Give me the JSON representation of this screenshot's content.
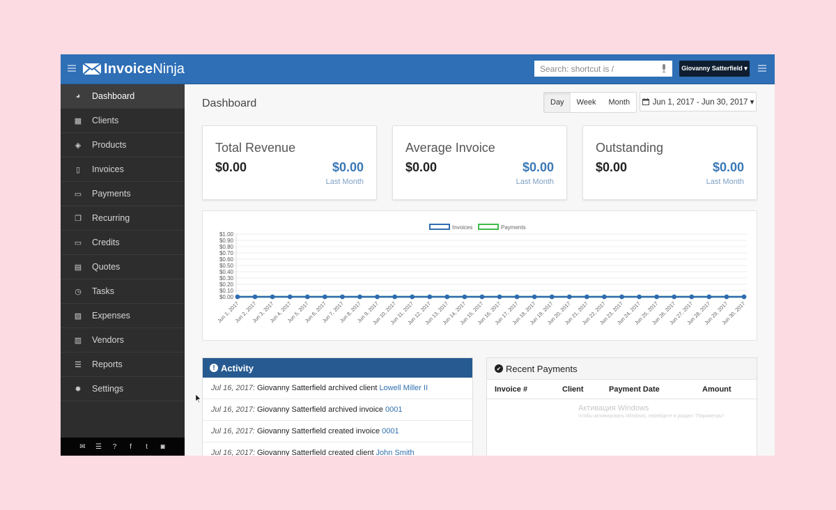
{
  "app": {
    "logo_bold": "Invoice",
    "logo_light": "Ninja"
  },
  "topbar": {
    "search_placeholder": "Search: shortcut is /",
    "user_name": "Giovanny Satterfield ▾"
  },
  "sidebar": {
    "items": [
      {
        "label": "Dashboard",
        "icon": "dashboard-icon",
        "active": true
      },
      {
        "label": "Clients",
        "icon": "users-icon"
      },
      {
        "label": "Products",
        "icon": "cube-icon"
      },
      {
        "label": "Invoices",
        "icon": "file-pdf-icon"
      },
      {
        "label": "Payments",
        "icon": "credit-card-icon"
      },
      {
        "label": "Recurring",
        "icon": "files-icon"
      },
      {
        "label": "Credits",
        "icon": "credit-card-icon"
      },
      {
        "label": "Quotes",
        "icon": "file-text-icon"
      },
      {
        "label": "Tasks",
        "icon": "clock-icon"
      },
      {
        "label": "Expenses",
        "icon": "file-image-icon"
      },
      {
        "label": "Vendors",
        "icon": "building-icon"
      },
      {
        "label": "Reports",
        "icon": "list-icon"
      },
      {
        "label": "Settings",
        "icon": "gear-icon"
      }
    ],
    "footer_icons": [
      "envelope-icon",
      "list-icon",
      "question-icon",
      "facebook-icon",
      "twitter-icon",
      "github-icon"
    ]
  },
  "main": {
    "title": "Dashboard",
    "range_buttons": [
      {
        "label": "Day",
        "active": true
      },
      {
        "label": "Week"
      },
      {
        "label": "Month"
      }
    ],
    "date_range": "Jun 1, 2017 - Jun 30, 2017 ▾",
    "cards": [
      {
        "label": "Total Revenue",
        "value": "$0.00",
        "compare_value": "$0.00",
        "compare_label": "Last Month"
      },
      {
        "label": "Average Invoice",
        "value": "$0.00",
        "compare_value": "$0.00",
        "compare_label": "Last Month"
      },
      {
        "label": "Outstanding",
        "value": "$0.00",
        "compare_value": "$0.00",
        "compare_label": "Last Month"
      }
    ]
  },
  "chart_data": {
    "type": "line",
    "title": "",
    "xlabel": "",
    "ylabel": "",
    "legend_position": "top-center",
    "grid": true,
    "ylim": [
      0,
      1
    ],
    "yticks": [
      "$1.00",
      "$0.90",
      "$0.80",
      "$0.70",
      "$0.60",
      "$0.50",
      "$0.40",
      "$0.30",
      "$0.20",
      "$0.10",
      "$0.00"
    ],
    "x": [
      "Jun 1, 2017",
      "Jun 2, 2017",
      "Jun 3, 2017",
      "Jun 4, 2017",
      "Jun 5, 2017",
      "Jun 6, 2017",
      "Jun 7, 2017",
      "Jun 8, 2017",
      "Jun 9, 2017",
      "Jun 10, 2017",
      "Jun 11, 2017",
      "Jun 12, 2017",
      "Jun 13, 2017",
      "Jun 14, 2017",
      "Jun 15, 2017",
      "Jun 16, 2017",
      "Jun 17, 2017",
      "Jun 18, 2017",
      "Jun 19, 2017",
      "Jun 20, 2017",
      "Jun 21, 2017",
      "Jun 22, 2017",
      "Jun 23, 2017",
      "Jun 24, 2017",
      "Jun 25, 2017",
      "Jun 26, 2017",
      "Jun 27, 2017",
      "Jun 28, 2017",
      "Jun 29, 2017",
      "Jun 30, 2017"
    ],
    "series": [
      {
        "name": "Invoices",
        "color": "#2e6bb1",
        "values": [
          0,
          0,
          0,
          0,
          0,
          0,
          0,
          0,
          0,
          0,
          0,
          0,
          0,
          0,
          0,
          0,
          0,
          0,
          0,
          0,
          0,
          0,
          0,
          0,
          0,
          0,
          0,
          0,
          0,
          0
        ]
      },
      {
        "name": "Payments",
        "color": "#3dbb4a",
        "values": [
          0,
          0,
          0,
          0,
          0,
          0,
          0,
          0,
          0,
          0,
          0,
          0,
          0,
          0,
          0,
          0,
          0,
          0,
          0,
          0,
          0,
          0,
          0,
          0,
          0,
          0,
          0,
          0,
          0,
          0
        ]
      }
    ]
  },
  "activity": {
    "title": "Activity",
    "rows": [
      {
        "date": "Jul 16, 2017:",
        "text": "Giovanny Satterfield archived client",
        "link": "Lowell Miller II"
      },
      {
        "date": "Jul 16, 2017:",
        "text": "Giovanny Satterfield archived invoice",
        "link": "0001"
      },
      {
        "date": "Jul 16, 2017:",
        "text": "Giovanny Satterfield created invoice",
        "link": "0001"
      },
      {
        "date": "Jul 16, 2017:",
        "text": "Giovanny Satterfield created client",
        "link": "John Smith"
      }
    ]
  },
  "payments": {
    "title": "Recent Payments",
    "columns": [
      "Invoice #",
      "Client",
      "Payment Date",
      "Amount"
    ],
    "rows": []
  },
  "watermark": {
    "line1": "Активация Windows",
    "line2": "Чтобы активировать Windows, перейдите в раздел \"Параметры\"."
  },
  "colors": {
    "brand": "#2e6fb6",
    "sidebar": "#2d2d2d",
    "accent_blue": "#3a78b5",
    "activity_header": "#275a90"
  }
}
